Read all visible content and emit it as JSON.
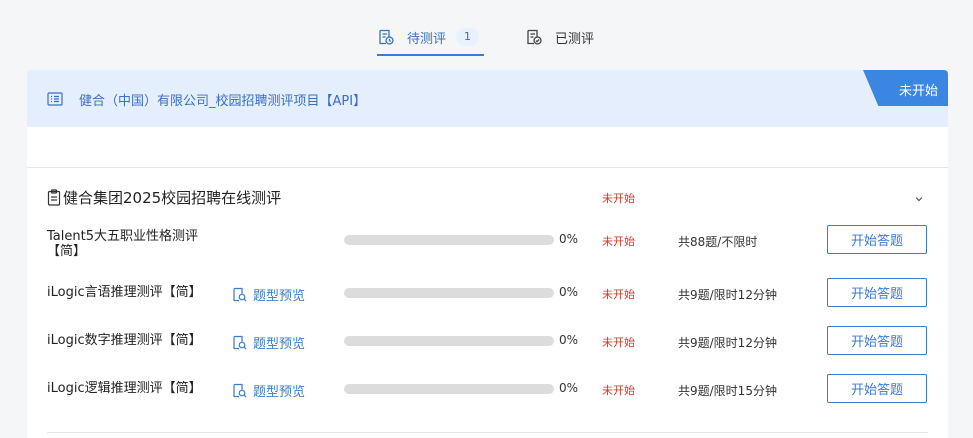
{
  "tabs": {
    "pending": {
      "label": "待测评",
      "count": "1"
    },
    "done": {
      "label": "已测评"
    }
  },
  "project": {
    "title": "健合（中国）有限公司_校园招聘测评项目【API】",
    "ribbon": "未开始"
  },
  "section": {
    "title": "健合集团2025校园招聘在线测评",
    "status": "未开始"
  },
  "preview_label": "题型预览",
  "start_label": "开始答题",
  "tests": [
    {
      "name_line1": "Talent5大五职业性格测评",
      "name_line2": "【简】",
      "progress": "0%",
      "progress_value": 0,
      "status": "未开始",
      "meta": "共88题/不限时"
    },
    {
      "name_line1": "iLogic言语推理测评【简】",
      "progress": "0%",
      "progress_value": 0,
      "status": "未开始",
      "meta": "共9题/限时12分钟"
    },
    {
      "name_line1": "iLogic数字推理测评【简】",
      "progress": "0%",
      "progress_value": 0,
      "status": "未开始",
      "meta": "共9题/限时12分钟"
    },
    {
      "name_line1": "iLogic逻辑推理测评【简】",
      "progress": "0%",
      "progress_value": 0,
      "status": "未开始",
      "meta": "共9题/限时15分钟"
    }
  ],
  "colors": {
    "accent": "#3a7bd5",
    "status_red": "#d9362b",
    "header_bg": "#e4eefc"
  }
}
